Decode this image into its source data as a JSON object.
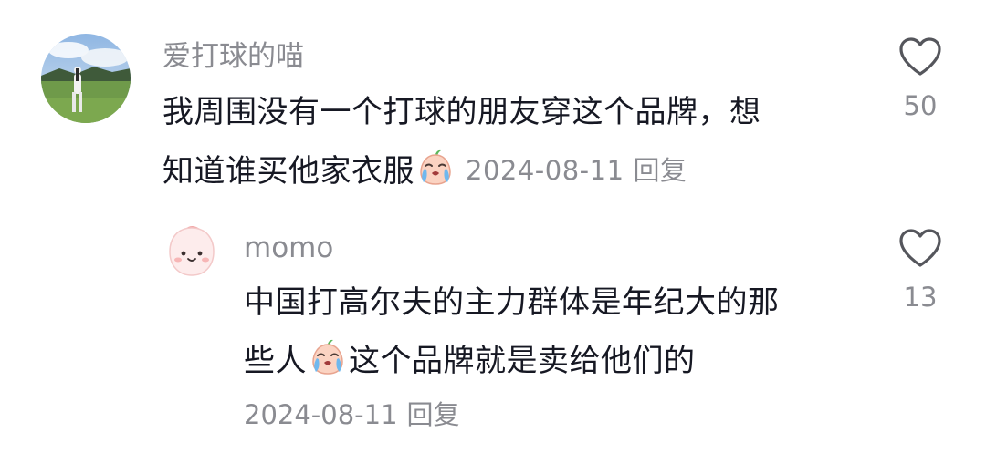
{
  "comment": {
    "username": "爱打球的喵",
    "text_line1": "我周围没有一个打球的朋友穿这个品牌，想",
    "text_line2": "知道谁买他家衣服",
    "emoji": "crying-face-emoji",
    "date": "2024-08-11",
    "reply_label": "回复",
    "likes": "50"
  },
  "reply": {
    "username": "momo",
    "text_line1": "中国打高尔夫的主力群体是年纪大的那",
    "text_line2_before": "些人",
    "text_line2_after": "这个品牌就是卖给他们的",
    "emoji": "crying-face-emoji",
    "date": "2024-08-11",
    "reply_label": "回复",
    "likes": "13"
  },
  "icons": {
    "like": "heart-outline-icon"
  },
  "colors": {
    "text_primary": "#161823",
    "text_secondary": "#8a8b91",
    "background": "#ffffff"
  }
}
